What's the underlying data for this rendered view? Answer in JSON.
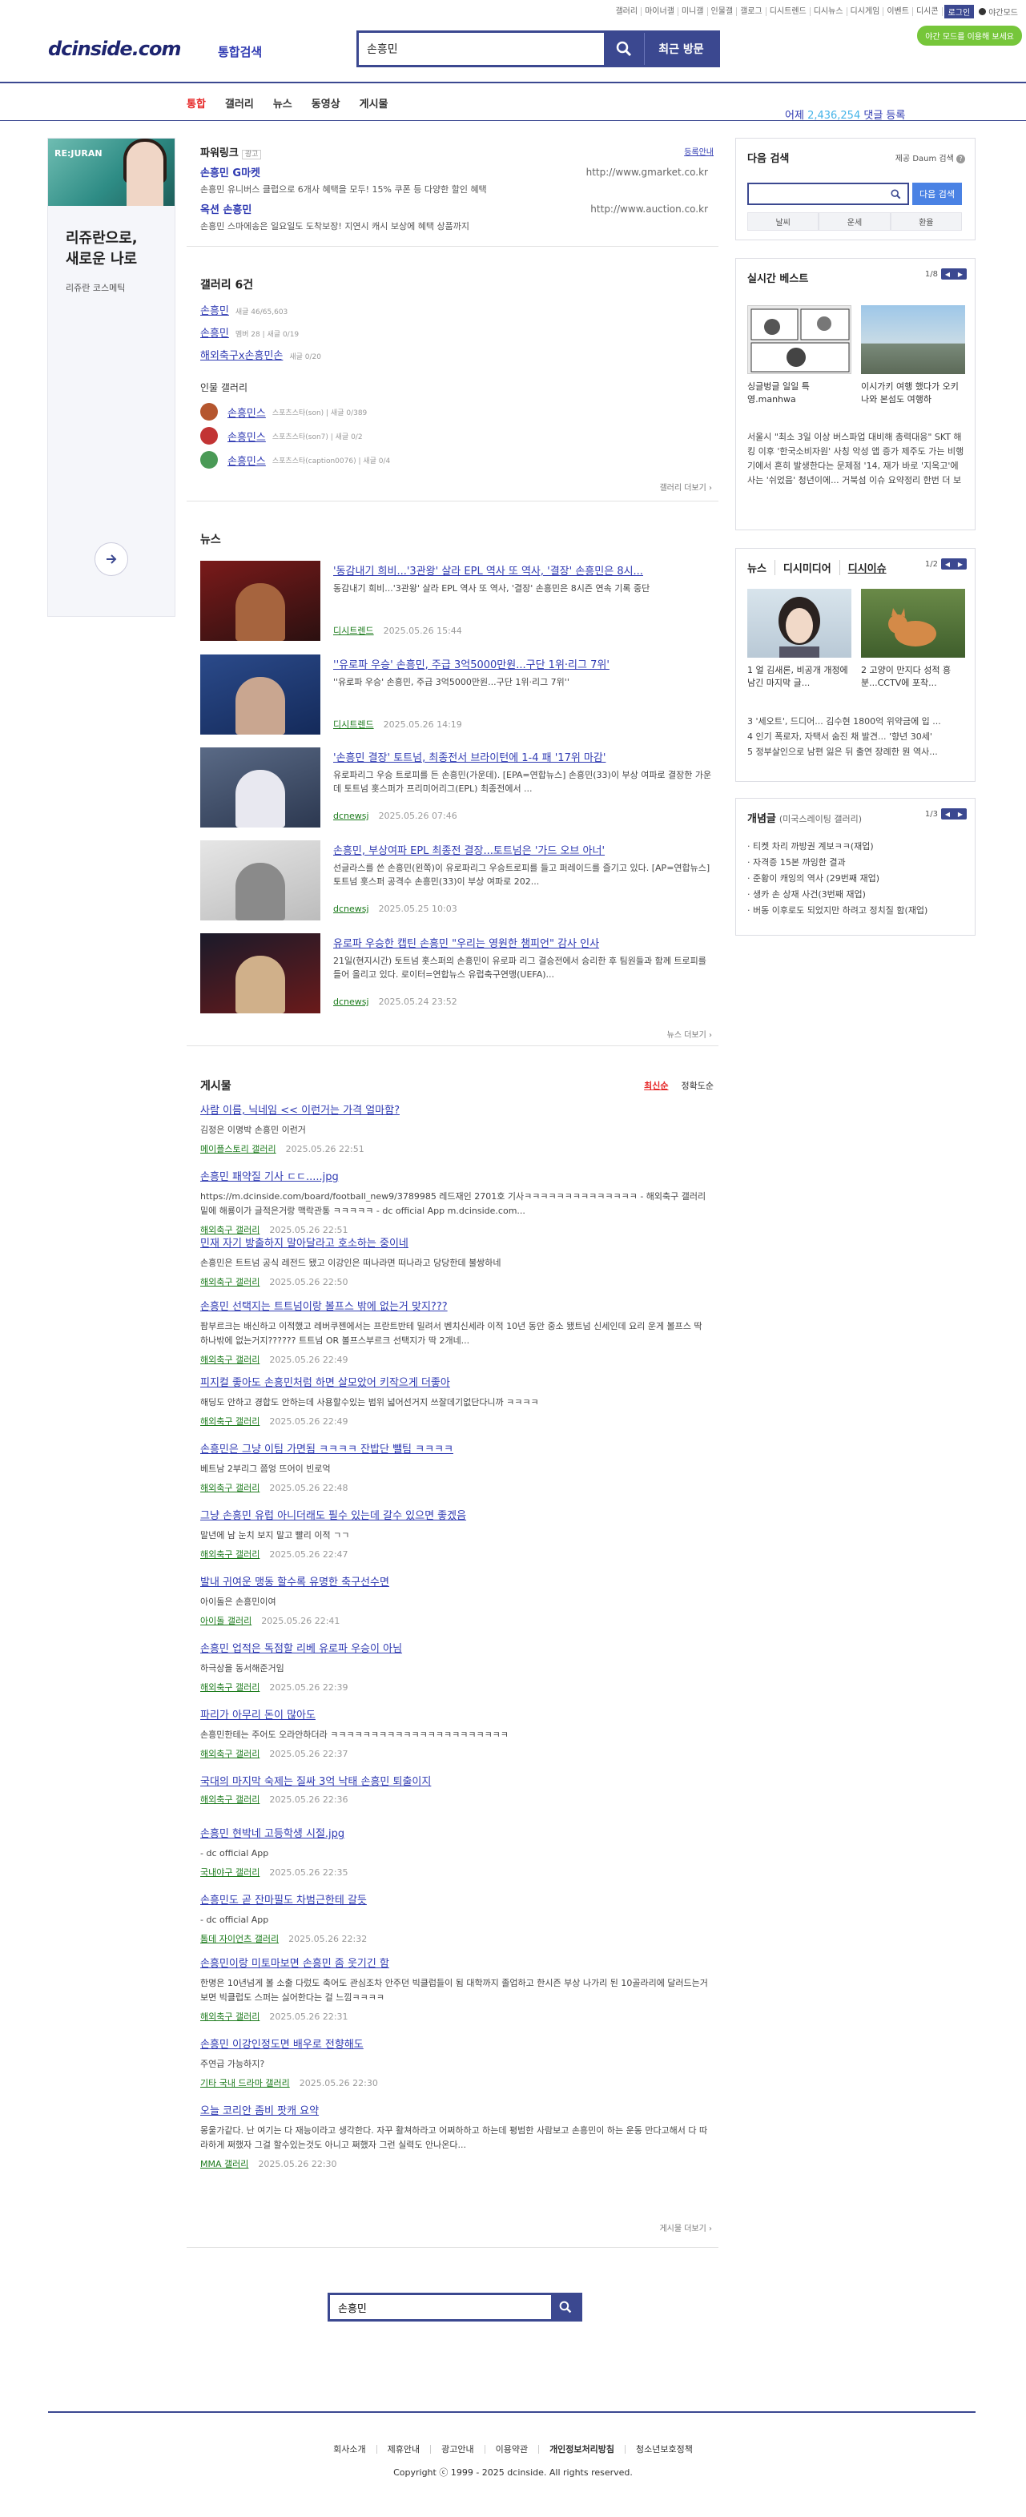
{
  "util": {
    "links": [
      "갤러리",
      "마이너갤",
      "미니갤",
      "인물갤",
      "갤로그",
      "디시트렌드",
      "디시뉴스",
      "디시게임",
      "이벤트",
      "디시콘"
    ],
    "login": "로그인",
    "dark_mode": "야간모드",
    "promo": "야간 모드를 이용해 보세요"
  },
  "header": {
    "logo": "dcinside.com",
    "logo_sub": "통합검색",
    "search_value": "손흥민",
    "recent_label": "최근 방문"
  },
  "nav": {
    "tabs": [
      "통합",
      "갤러리",
      "뉴스",
      "동영상",
      "게시물"
    ],
    "active": "통합",
    "comment_prefix": "어제",
    "comment_count": "2,436,254",
    "comment_suffix": "댓글 등록"
  },
  "left_ad": {
    "brand": "RE:JURAN",
    "headline_1": "리쥬란으로,",
    "headline_2": "새로운 나로",
    "sub": "리쥬란 코스메틱"
  },
  "powerlink": {
    "title": "파워링크",
    "badge": "광고",
    "guide": "등록안내",
    "items": [
      {
        "title": "손흥민 G마켓",
        "desc": "손흥민 유니버스 클럽으로 6개사 혜택을 모두! 15% 쿠폰 등 다양한 할인 혜택",
        "url": "http://www.gmarket.co.kr"
      },
      {
        "title": "옥션 손흥민",
        "desc": "손흥민 스마에송은 일요일도 도착보장! 지연시 캐시 보상에 혜택 상품까지",
        "url": "http://www.auction.co.kr"
      }
    ]
  },
  "gallery": {
    "title": "갤러리 6건",
    "items": [
      {
        "name": "손흥민",
        "stat": "새글 46/65,603"
      },
      {
        "name": "손흥민",
        "stat": "멤버 28 | 새글 0/19"
      },
      {
        "name": "해외축구x손흥민손",
        "stat": "새글 0/20"
      }
    ],
    "person_title": "인물 갤러리",
    "person_items": [
      {
        "name": "손흥민스",
        "stat": "스포츠스타(son) | 새글 0/389"
      },
      {
        "name": "손흥민스",
        "stat": "스포츠스타(son7) | 새글 0/2"
      },
      {
        "name": "손흥민스",
        "stat": "스포츠스타(caption0076) | 새글 0/4"
      }
    ],
    "more": "갤러리 더보기 ›"
  },
  "news": {
    "title": "뉴스",
    "items": [
      {
        "title": "'동감내기 희비...'3관왕' 살라 EPL 역사 또 역사, '결장' 손흥민은 8시...",
        "desc": "동감내기 희비...'3관왕' 살라 EPL 역사 또 역사, '결장' 손흥민은 8시즌 연속 기록 중단",
        "src": "디시트렌드",
        "date": "2025.05.26 15:44"
      },
      {
        "title": "''유로파 우승' 손흥민, 주급 3억5000만원...구단 1위·리그 7위'",
        "desc": "''유로파 우승' 손흥민, 주급 3억5000만원...구단 1위·리그 7위''",
        "src": "디시트렌드",
        "date": "2025.05.26 14:19"
      },
      {
        "title": "'손흥민 결장' 토트넘, 최종전서 브라이턴에 1-4 패 '17위 마감'",
        "desc": "유로파리그 우승 트로피를 든 손흥민(가운데). [EPA=연합뉴스] 손흥민(33)이 부상 여파로 결장한 가운데 토트넘 홋스퍼가 프리미어리그(EPL) 최종전에서 ...",
        "src": "dcnewsj",
        "date": "2025.05.26 07:46"
      },
      {
        "title": "손흥민, 부상여파 EPL 최종전 결장...토트넘은 '가드 오브 아너'",
        "desc": "선글라스를 쓴 손흥민(왼쪽)이 유로파리그 우승트로피를 들고 퍼레이드를 즐기고 있다. [AP=연합뉴스] 토트넘 홋스퍼 공격수 손흥민(33)이 부상 여파로 202...",
        "src": "dcnewsj",
        "date": "2025.05.25 10:03"
      },
      {
        "title": "유로파 우승한 캡틴 손흥민 \"우리는 영원한 챔피언\" 감사 인사",
        "desc": "21일(현지시간) 토트넘 홋스퍼의 손흥민이 유로파 리그 결승전에서 승리한 후 팀원들과 함께 트로피를 들어 올리고 있다. 로이터=연합뉴스 유럽축구연맹(UEFA)...",
        "src": "dcnewsj",
        "date": "2025.05.24 23:52"
      }
    ],
    "more": "뉴스 더보기 ›"
  },
  "posts": {
    "title": "게시물",
    "sort_new": "최신순",
    "sort_acc": "정확도순",
    "items": [
      {
        "title": "사람 이름, 닉네임 << 이런거는 가격 얼마함?",
        "desc": "김정은 이명박 손흥민 이런거",
        "src": "메이플스토리 갤러리",
        "date": "2025.05.26 22:51"
      },
      {
        "title": "손흥민 패약질 기사 ㄷㄷ.....jpg",
        "desc": "https://m.dcinside.com/board/football_new9/3789985 레드재인 2701호 기사ㅋㅋㅋㅋㅋㅋㅋㅋㅋㅋㅋㅋㅋㅋ - 해외축구 갤러리 밑에 해룡이가 글적은거랑 맥락관통 ㅋㅋㅋㅋㅋ - dc official App m.dcinside.com...",
        "src": "해외축구 갤러리",
        "date": "2025.05.26 22:51"
      },
      {
        "title": "민재 자기 방출하지 말아달라고 호소하는 중이네",
        "desc": "손흥민은 트트넘 공식 레전드 됐고 이강인은 떠나라면 떠나라고 당당한데 불쌍하네",
        "src": "해외축구 갤러리",
        "date": "2025.05.26 22:50"
      },
      {
        "title": "손흥민 선택지는 트트넘이랑 볼프스 밖에 없는거 맞지???",
        "desc": "팜부르크는 배신하고 이적했고 레버쿠젠에서는 프란트반테 밀려서 벤치신세라 이적 10년 동안 중소 됐트넘 신세인데 요리 운게 볼프스 딱 하나밖에 없는거지?????? 트트넘 OR 볼프스부르크 선택지가 딱 2개네...",
        "src": "해외축구 갤러리",
        "date": "2025.05.26 22:49"
      },
      {
        "title": "피지컬 좋아도 손흥민처럼 하면 살모았어 키작으게 더좋아",
        "desc": "해딩도 안하고 경합도 안하는데 사용할수있는 범위 넓어선거지 쓰잘데기없단다니까 ㅋㅋㅋㅋ",
        "src": "해외축구 갤러리",
        "date": "2025.05.26 22:49"
      },
      {
        "title": "손흥민은 그냥 이팀 가면됨 ㅋㅋㅋㅋ 잔밥단 뺄팀 ㅋㅋㅋㅋ",
        "desc": "베트남 2부리그 쯤엉 뜨어이 빈로억",
        "src": "해외축구 갤러리",
        "date": "2025.05.26 22:48"
      },
      {
        "title": "그냥 손흥민 유럽 아니더래도 필수 있는데 갈수 있으면 좋겠음",
        "desc": "말년에 남 눈치 보지 말고 빨리 이적 ㄱㄱ",
        "src": "해외축구 갤러리",
        "date": "2025.05.26 22:47"
      },
      {
        "title": "발내 귀여운 맹동 할수록 유명한 축구선수면",
        "desc": "아이돌은 손흥민이여",
        "src": "아이돌 갤러리",
        "date": "2025.05.26 22:41"
      },
      {
        "title": "손흥민 업적은 독점할 리베 유로파 우승이 아님",
        "desc": "하극상을 동서해준거임",
        "src": "해외축구 갤러리",
        "date": "2025.05.26 22:39"
      },
      {
        "title": "파리가 아무리 돈이 많아도",
        "desc": "손흥민한테는 주어도 오라안하더라 ㅋㅋㅋㅋㅋㅋㅋㅋㅋㅋㅋㅋㅋㅋㅋㅋㅋㅋㅋㅋㅋㅋ",
        "src": "해외축구 갤러리",
        "date": "2025.05.26 22:37"
      },
      {
        "title": "국대의 마지막 숙제는 질싸 3억 낙태 손흥민 퇴출이지",
        "desc": "",
        "src": "해외축구 갤러리",
        "date": "2025.05.26 22:36"
      },
      {
        "title": "손흥민 현박네 고등학생 시절.jpg",
        "desc": "- dc official App",
        "src": "국내야구 갤러리",
        "date": "2025.05.26 22:35"
      },
      {
        "title": "손흥민도 곧 잔마필도 차범근한테 갈듯",
        "desc": "- dc official App",
        "src": "톰데 자이언츠 갤러리",
        "date": "2025.05.26 22:32"
      },
      {
        "title": "손흥민이랑 미토마보면 손흥민 좀 웃기긴 함",
        "desc": "한명은 10년넘게 볼 소출 다렀도 축어도 관심조차 안주던 빅클럽들이 됨 대학까지 졸업하고 한시즌 부상 나가리 된 10골라리에 달러드는거보면 빅클럽도 스퍼는 싫어한다는 걸 느낌ㅋㅋㅋㅋ",
        "src": "해외축구 갤러리",
        "date": "2025.05.26 22:31"
      },
      {
        "title": "손흥민 이강인정도면 배우로 전향해도",
        "desc": "주연급 가능하지?",
        "src": "기타 국내 드라마 갤러리",
        "date": "2025.05.26 22:30"
      },
      {
        "title": "오늘 코리안 좀비 팟캐 요약",
        "desc": "몽울가같다. 난 여기는 다 재능이라고 생각한다. 자꾸 활쳐하라고 어쩌하하고 하는데 평범한 사람보고 손흥민이 하는 운동 만다고해서 다 따라하게 쩌했자 그걸 할수있는것도 아니고 쩌했자 그런 실력도 안나온다...",
        "src": "MMA 갤러리",
        "date": "2025.05.26 22:30"
      }
    ],
    "more": "게시물 더보기 ›"
  },
  "bottom_search": {
    "value": "손흥민"
  },
  "daum": {
    "title": "다음 검색",
    "option": "제공 Daum 검색",
    "button": "다음 검색",
    "tabs": [
      "날씨",
      "운세",
      "환율"
    ]
  },
  "realtime": {
    "title": "실시간 베스트",
    "page": "1/8",
    "thumbs": [
      {
        "caption": "싱글벙글 일일 특영.manhwa"
      },
      {
        "caption": "이시가키 여행 했다가 오키나와 본섬도 여행하"
      }
    ],
    "body": "서울시 \"최소 3일 이상 버스파업 대비해 총력대응\" SKT 해킹 이후 '한국소비자원' 사칭 악성 앱 증가 제주도 가는 비행기에서 혼히 발생한다는 문제점 '14, 재가 바로 '지옥고'에 사는 '쉬었음' 청년이에... 거북섬 이슈 요약정리 한번 더 보완해서 해주고 ..."
  },
  "issue": {
    "tabs": [
      "뉴스",
      "디시미디어",
      "디시이슈"
    ],
    "page": "1/2",
    "thumbs": [
      {
        "caption": "1 얼 김새론, 비공개 개정에 남긴 마지막 글..."
      },
      {
        "caption": "2 고양이 만지다 성적 흥분...CCTV에 포착..."
      }
    ],
    "list": [
      "3 '세오트', 드디어... 김수현 1800억 위약금에 입 ...",
      "4 인기 폭로자, 자택서 숨진 채 발견... '향년 30세'",
      "5 정부살인으로 남편 잃은 뒤 출연 장례한 뭔 역사..."
    ]
  },
  "concept": {
    "title": "개념글",
    "sub": "(미국스레이팅 갤러리)",
    "page": "1/3",
    "list": [
      "티켓 차리 까방권 계보ㅋㅋ(재업)",
      "자격증 15본 까잉한 결과",
      "준황이 캐잉의 역사 (29번째 재업)",
      "생카 손 상재 사건(3번째 재업)",
      "버동 이후로도 되었지만 하려고 정치질 함(재업)"
    ]
  },
  "footer": {
    "links": [
      "회사소개",
      "제휴안내",
      "광고안내",
      "이용약관",
      "개인정보처리방침",
      "청소년보호정책"
    ],
    "bold": "개인정보처리방침",
    "copyright": "Copyright ⓒ 1999 - 2025 dcinside. All rights reserved."
  }
}
